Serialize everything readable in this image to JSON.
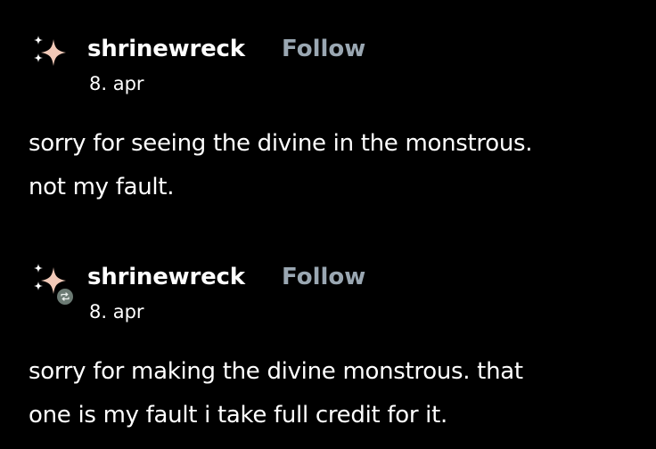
{
  "posts": [
    {
      "username": "shrinewreck",
      "follow_label": "Follow",
      "date": "8. apr",
      "lines": [
        "sorry for seeing the divine in the monstrous.",
        "not my fault."
      ],
      "avatar_icon": "sparkle-icon",
      "avatar_color": "#f2c9b8"
    },
    {
      "username": "shrinewreck",
      "follow_label": "Follow",
      "date": "8. apr",
      "lines": [
        "sorry for making the divine monstrous. that",
        "one is my fault i take full credit for it."
      ],
      "avatar_icon": "sparkle-icon",
      "avatar_color": "#f2c9b8",
      "badge_icon": "reblog-icon",
      "badge_color": "#6b7a73"
    }
  ],
  "colors": {
    "background": "#000000",
    "text": "#ffffff",
    "follow": "#9aa7b2"
  }
}
